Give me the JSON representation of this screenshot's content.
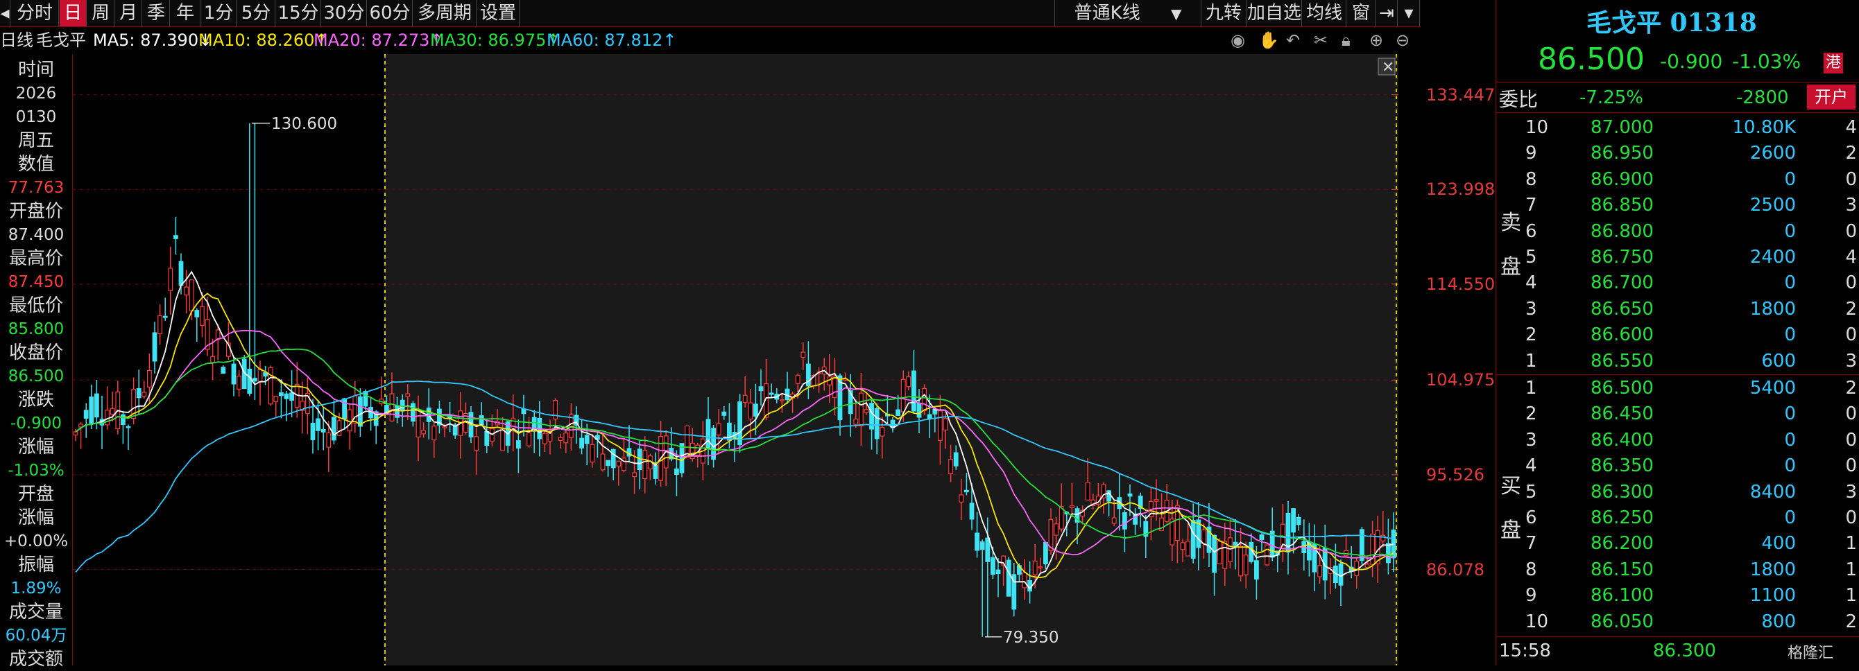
{
  "toolbar": {
    "tabs": [
      "分时",
      "日",
      "周",
      "月",
      "季",
      "年",
      "1分",
      "5分",
      "15分",
      "30分",
      "60分",
      "多周期",
      "设置"
    ],
    "active_tab": "日",
    "kline_type": "普通K线",
    "right_buttons": [
      "九转",
      "加自选",
      "均线",
      "窗"
    ]
  },
  "ma_line": {
    "period_label": "日线",
    "stock_name": "毛戈平",
    "ma5": "MA5: 87.390↓",
    "ma10": "MA10: 88.260↑",
    "ma20": "MA20: 87.273↑",
    "ma30": "MA30: 86.975↑",
    "ma60": "MA60: 87.812↑",
    "colors": {
      "ma5": "#ffffff",
      "ma10": "#f7e600",
      "ma20": "#ff66ff",
      "ma30": "#25e03b",
      "ma60": "#31c7ff"
    }
  },
  "left_panel": {
    "time_label": "时间",
    "year": "2026",
    "date": "0130",
    "weekday": "周五",
    "value_label": "数值",
    "value": "77.763",
    "open_label": "开盘价",
    "open": "87.400",
    "high_label": "最高价",
    "high": "87.450",
    "low_label": "最低价",
    "low": "85.800",
    "close_label": "收盘价",
    "close": "86.500",
    "change_label": "涨跌",
    "change": "-0.900",
    "pct_label": "涨幅",
    "pct": "-1.03%",
    "open_pct_label1": "开盘",
    "open_pct_label2": "涨幅",
    "open_pct": "+0.00%",
    "amp_label": "振幅",
    "amp": "1.89%",
    "vol_label": "成交量",
    "vol": "60.04万",
    "amount_label": "成交额"
  },
  "chart_data": {
    "type": "candlestick",
    "y_ticks": [
      "133.447",
      "123.998",
      "114.550",
      "104.975",
      "95.526",
      "86.078"
    ],
    "y_tick_values": [
      133.447,
      123.998,
      114.55,
      104.975,
      95.526,
      86.078
    ],
    "ylim": [
      76.5,
      137.5
    ],
    "max_label": "130.600",
    "min_label": "79.350",
    "max_value": 130.6,
    "min_value": 79.35
  },
  "quote": {
    "title": "毛戈平 01318",
    "price": "86.500",
    "change": "-0.900",
    "pct": "-1.03%",
    "market_badge": "港",
    "weibi_label": "委比",
    "weibi": "-7.25%",
    "weicha": "-2800",
    "account_button": "开户",
    "sell_label_1": "卖",
    "sell_label_2": "盘",
    "buy_label_1": "买",
    "buy_label_2": "盘",
    "asks": [
      {
        "level": "10",
        "price": "87.000",
        "vol": "10.80K",
        "n": "4"
      },
      {
        "level": "9",
        "price": "86.950",
        "vol": "2600",
        "n": "2"
      },
      {
        "level": "8",
        "price": "86.900",
        "vol": "0",
        "n": "0"
      },
      {
        "level": "7",
        "price": "86.850",
        "vol": "2500",
        "n": "3"
      },
      {
        "level": "6",
        "price": "86.800",
        "vol": "0",
        "n": "0"
      },
      {
        "level": "5",
        "price": "86.750",
        "vol": "2400",
        "n": "4"
      },
      {
        "level": "4",
        "price": "86.700",
        "vol": "0",
        "n": "0"
      },
      {
        "level": "3",
        "price": "86.650",
        "vol": "1800",
        "n": "2"
      },
      {
        "level": "2",
        "price": "86.600",
        "vol": "0",
        "n": "0"
      },
      {
        "level": "1",
        "price": "86.550",
        "vol": "600",
        "n": "3"
      }
    ],
    "bids": [
      {
        "level": "1",
        "price": "86.500",
        "vol": "5400",
        "n": "2"
      },
      {
        "level": "2",
        "price": "86.450",
        "vol": "0",
        "n": "0"
      },
      {
        "level": "3",
        "price": "86.400",
        "vol": "0",
        "n": "0"
      },
      {
        "level": "4",
        "price": "86.350",
        "vol": "0",
        "n": "0"
      },
      {
        "level": "5",
        "price": "86.300",
        "vol": "8400",
        "n": "3"
      },
      {
        "level": "6",
        "price": "86.250",
        "vol": "0",
        "n": "0"
      },
      {
        "level": "7",
        "price": "86.200",
        "vol": "400",
        "n": "1"
      },
      {
        "level": "8",
        "price": "86.150",
        "vol": "1800",
        "n": "1"
      },
      {
        "level": "9",
        "price": "86.100",
        "vol": "1100",
        "n": "1"
      },
      {
        "level": "10",
        "price": "86.050",
        "vol": "800",
        "n": "2"
      }
    ],
    "tick_time": "15:58",
    "tick_price": "86.300",
    "logo_text": "格隆汇"
  }
}
